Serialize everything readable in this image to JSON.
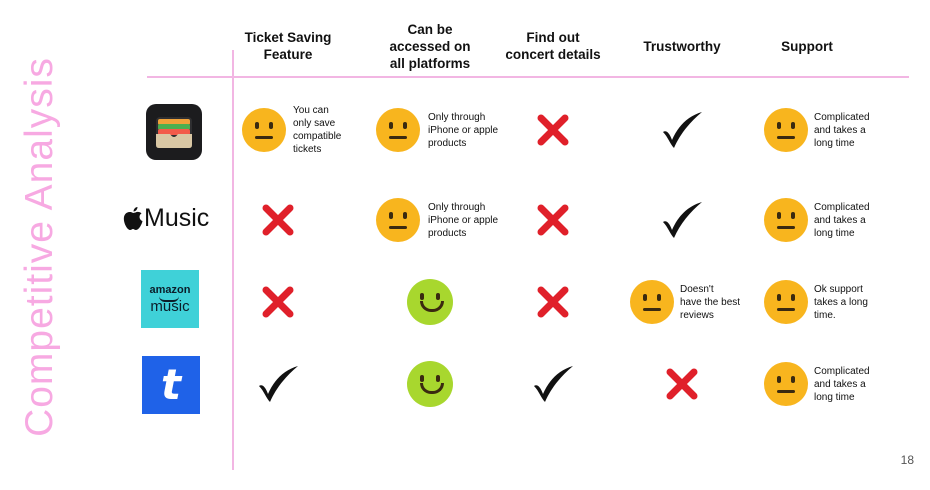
{
  "title": "Competitive Analysis",
  "page_number": "18",
  "columns": [
    "Ticket Saving\nFeature",
    "Can be\naccessed on\nall platforms",
    "Find out\nconcert details",
    "Trustworthy",
    "Support"
  ],
  "rows": [
    {
      "app": "wallet-app-icon",
      "cells": [
        {
          "icon": "neutral-face-icon",
          "note": "You can\nonly save\ncompatible\ntickets"
        },
        {
          "icon": "neutral-face-icon",
          "note": "Only through\niPhone or apple\nproducts"
        },
        {
          "icon": "cross-icon",
          "note": ""
        },
        {
          "icon": "check-icon",
          "note": ""
        },
        {
          "icon": "neutral-face-icon",
          "note": "Complicated\nand takes a\nlong time"
        }
      ]
    },
    {
      "app": "apple-music-logo",
      "logo_text": "Music",
      "cells": [
        {
          "icon": "cross-icon",
          "note": ""
        },
        {
          "icon": "neutral-face-icon",
          "note": "Only through\niPhone or apple\nproducts"
        },
        {
          "icon": "cross-icon",
          "note": ""
        },
        {
          "icon": "check-icon",
          "note": ""
        },
        {
          "icon": "neutral-face-icon",
          "note": "Complicated\nand takes a\nlong time"
        }
      ]
    },
    {
      "app": "amazon-music-logo",
      "logo_text_top": "amazon",
      "logo_text_bottom": "music",
      "cells": [
        {
          "icon": "cross-icon",
          "note": ""
        },
        {
          "icon": "happy-face-icon",
          "note": ""
        },
        {
          "icon": "cross-icon",
          "note": ""
        },
        {
          "icon": "neutral-face-icon",
          "note": "Doesn't\nhave the best\nreviews"
        },
        {
          "icon": "neutral-face-icon",
          "note": "Ok support\ntakes a long\ntime."
        }
      ]
    },
    {
      "app": "ticketmaster-logo",
      "logo_text": "t",
      "cells": [
        {
          "icon": "check-icon",
          "note": ""
        },
        {
          "icon": "happy-face-icon",
          "note": ""
        },
        {
          "icon": "check-icon",
          "note": ""
        },
        {
          "icon": "cross-icon",
          "note": ""
        },
        {
          "icon": "neutral-face-icon",
          "note": "Complicated\nand takes a\nlong time"
        }
      ]
    }
  ],
  "colors": {
    "accent_pink": "#f7a9e2",
    "neutral_face": "#f8b51e",
    "happy_face": "#a8d72e",
    "cross": "#e0202a",
    "amazon_bg": "#3fd1d8",
    "ticketmaster_bg": "#1f62e8"
  }
}
